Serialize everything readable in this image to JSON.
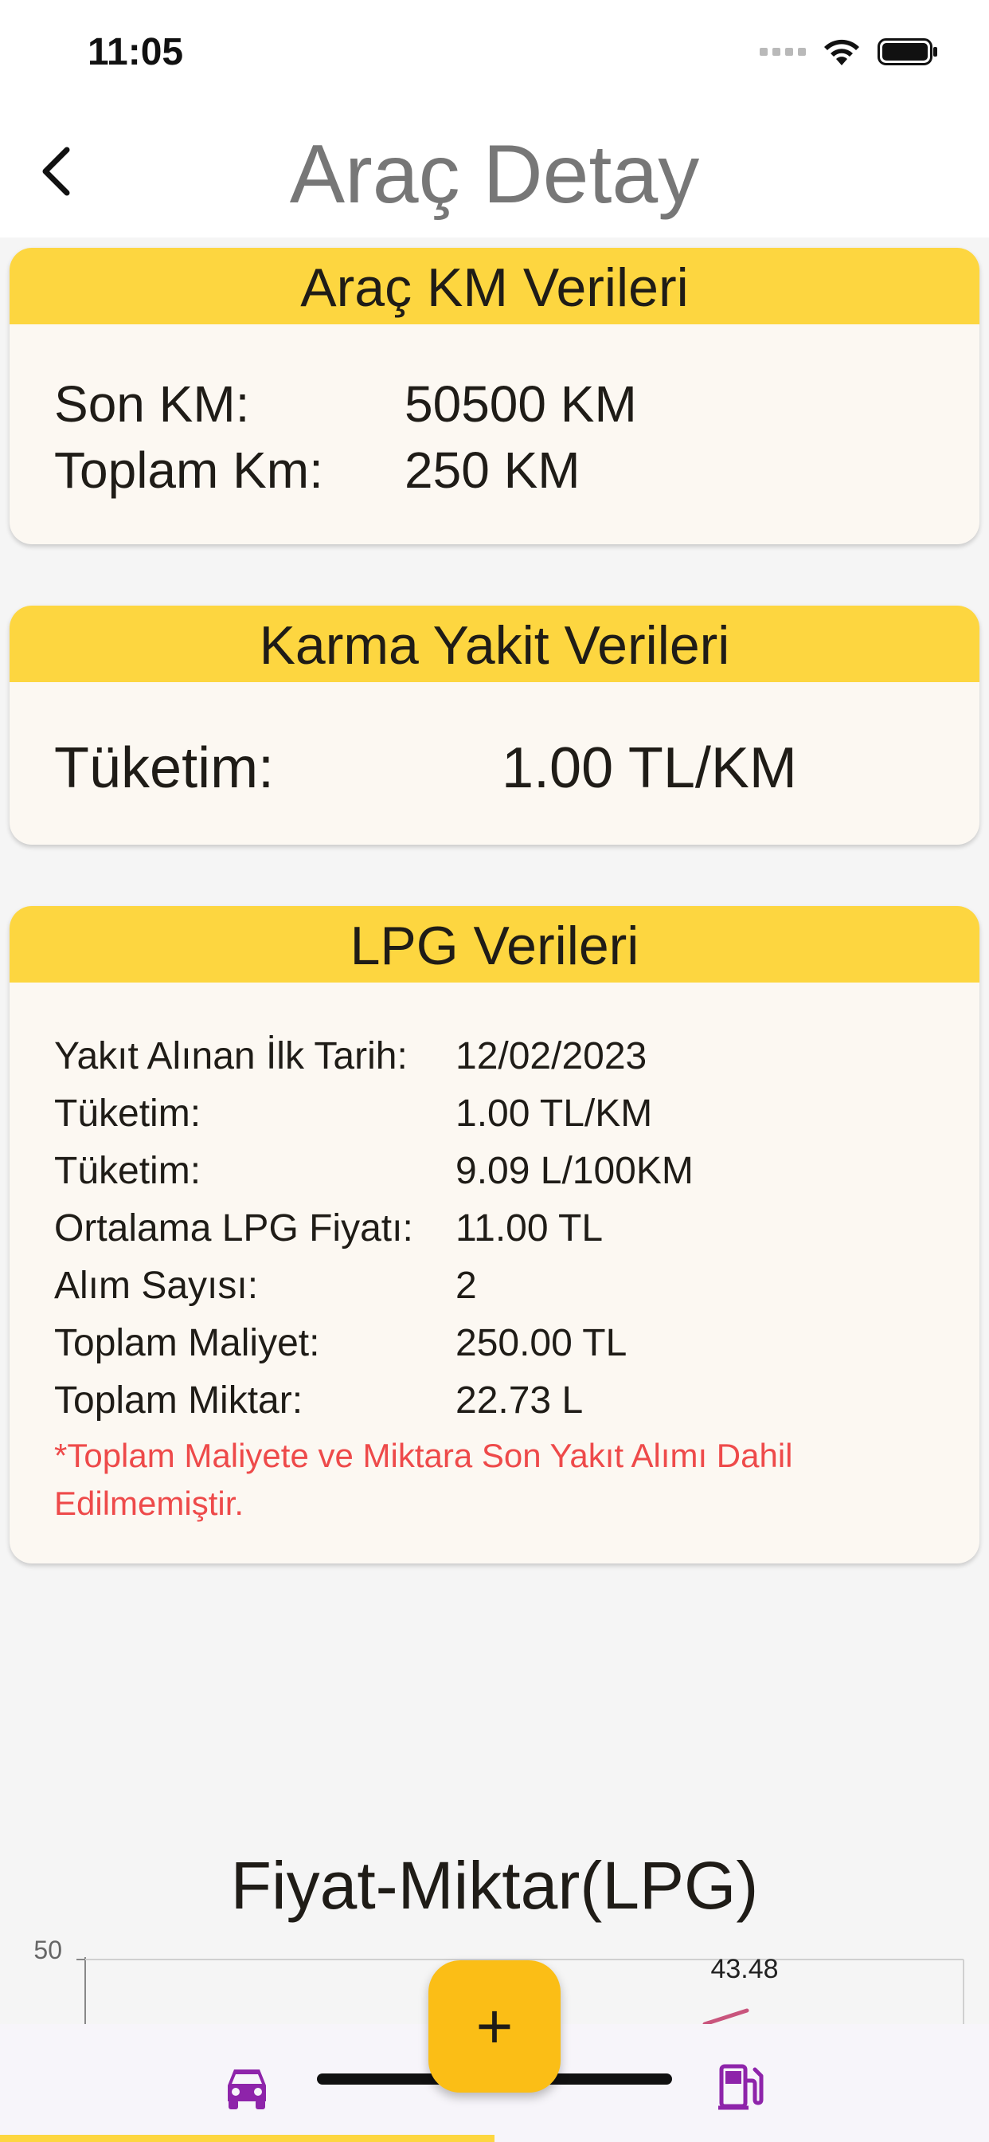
{
  "status_bar": {
    "time": "11:05"
  },
  "nav": {
    "title": "Araç Detay"
  },
  "km_card": {
    "title": "Araç KM Verileri",
    "rows": [
      {
        "label": "Son KM:",
        "value": "50500 KM"
      },
      {
        "label": "Toplam Km:",
        "value": "250 KM"
      }
    ]
  },
  "mixed_card": {
    "title": "Karma Yakit Verileri",
    "rows": [
      {
        "label": "Tüketim:",
        "value": "1.00 TL/KM"
      }
    ]
  },
  "lpg_card": {
    "title": "LPG Verileri",
    "rows": [
      {
        "label": "Yakıt Alınan İlk Tarih:",
        "value": "12/02/2023"
      },
      {
        "label": "Tüketim:",
        "value": "1.00 TL/KM"
      },
      {
        "label": "Tüketim:",
        "value": "9.09 L/100KM"
      },
      {
        "label": "Ortalama LPG Fiyatı:",
        "value": "11.00 TL"
      },
      {
        "label": "Alım Sayısı:",
        "value": "2"
      },
      {
        "label": "Toplam Maliyet:",
        "value": "250.00 TL"
      },
      {
        "label": "Toplam Miktar:",
        "value": "22.73 L"
      }
    ],
    "note": "*Toplam Maliyete ve Miktara Son Yakıt Alımı Dahil Edilmemiştir."
  },
  "chart": {
    "title": "Fiyat-Miktar(LPG)",
    "y_tick_top": "50",
    "point_label": "43.48",
    "line_color": "#c9557d",
    "point_value": 43.48,
    "y_max": 50
  },
  "fab": {
    "label": "+"
  },
  "colors": {
    "header_yellow": "#fdd640",
    "fab_yellow": "#fbbe16",
    "note_red": "#ee4a4a",
    "nav_purple": "#8e24aa"
  },
  "icons": {
    "back": "chevron-left-icon",
    "car_tab": "car-icon",
    "fuel_tab": "fuel-pump-icon"
  }
}
